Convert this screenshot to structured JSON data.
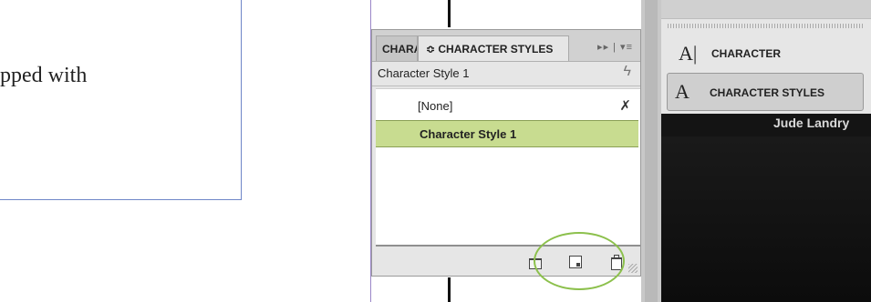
{
  "document": {
    "visible_text": "pped with"
  },
  "panel": {
    "tabs": [
      {
        "label": "CHARACTER"
      },
      {
        "label": "≎ CHARACTER STYLES"
      }
    ],
    "controls": "▸▸ | ▾≡",
    "current_style": "Character Style 1",
    "styles": [
      {
        "label": "[None]"
      },
      {
        "label": "Character Style 1",
        "selected": true
      }
    ]
  },
  "dock": {
    "items": [
      {
        "icon": "A|",
        "label": "CHARACTER"
      },
      {
        "icon": "A",
        "label": "CHARACTER STYLES"
      }
    ]
  },
  "background": {
    "author": "Jude Landry"
  },
  "colors": {
    "selection": "#c8dc90",
    "highlight_circle": "#8cc04c",
    "guide": "#9a86c8"
  }
}
